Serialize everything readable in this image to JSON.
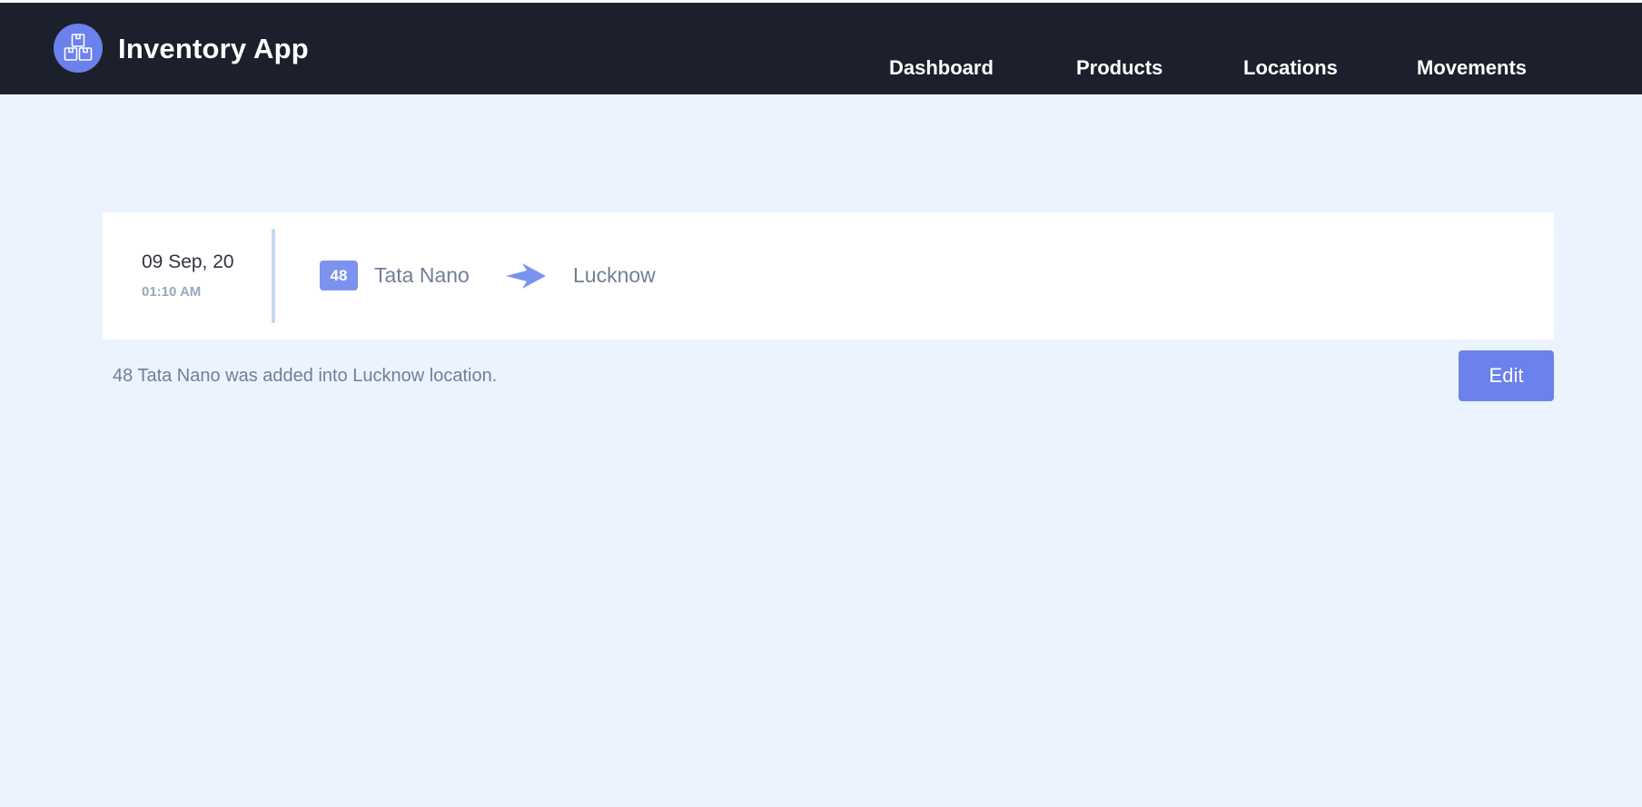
{
  "app": {
    "title": "Inventory App",
    "logo_icon": "boxes-icon",
    "accent_color": "#6b81eb",
    "nav_background": "#1b202c",
    "page_background": "#ebf3fe"
  },
  "nav": {
    "items": [
      {
        "label": "Dashboard"
      },
      {
        "label": "Products"
      },
      {
        "label": "Locations"
      },
      {
        "label": "Movements"
      }
    ]
  },
  "movement": {
    "date": "09 Sep, 20",
    "time": "01:10 AM",
    "quantity": "48",
    "product": "Tata Nano",
    "direction_icon": "arrow-right-icon",
    "location": "Lucknow",
    "description": "48 Tata Nano was added into Lucknow location.",
    "edit_label": "Edit"
  }
}
